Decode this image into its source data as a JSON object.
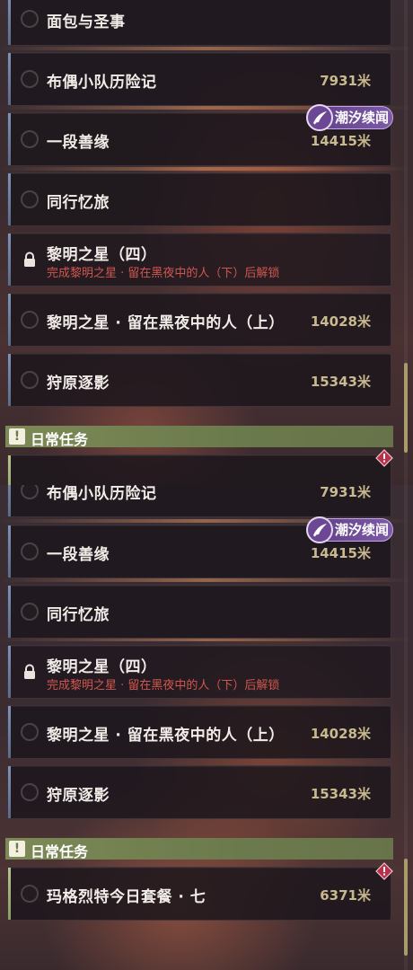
{
  "colors": {
    "accent_blue": "#7f93b6",
    "accent_daily": "#b7c48a",
    "lock_hint": "#d0574f",
    "distance_text": "#c9b98f",
    "badge_purple": "#6b4794",
    "section_green": "#7d8a57"
  },
  "panel1": {
    "quests": [
      {
        "title": "面包与圣事",
        "distance": ""
      },
      {
        "title": "布偶小队历险记",
        "distance": "7931米"
      },
      {
        "title": "一段善缘",
        "distance": "14415米",
        "badge": "潮汐续闻"
      },
      {
        "title": "同行忆旅",
        "distance": ""
      },
      {
        "title": "黎明之星（四）",
        "locked": true,
        "hint": "完成黎明之星 · 留在黑夜中的人（下）后解锁"
      },
      {
        "title": "黎明之星 · 留在黑夜中的人（上）",
        "distance": "14028米"
      },
      {
        "title": "狩原逐影",
        "distance": "15343米"
      }
    ],
    "section": {
      "label": "日常任务",
      "icon": "alert-square-icon"
    }
  },
  "panel2": {
    "quests": [
      {
        "title": "布偶小队历险记",
        "distance": "7931米"
      },
      {
        "title": "一段善缘",
        "distance": "14415米",
        "badge": "潮汐续闻"
      },
      {
        "title": "同行忆旅",
        "distance": ""
      },
      {
        "title": "黎明之星（四）",
        "locked": true,
        "hint": "完成黎明之星 · 留在黑夜中的人（下）后解锁"
      },
      {
        "title": "黎明之星 · 留在黑夜中的人（上）",
        "distance": "14028米"
      },
      {
        "title": "狩原逐影",
        "distance": "15343米"
      }
    ],
    "section": {
      "label": "日常任务",
      "icon": "alert-square-icon"
    },
    "daily_quests": [
      {
        "title": "玛格烈特今日套餐 · 七",
        "distance": "6371米"
      }
    ]
  }
}
